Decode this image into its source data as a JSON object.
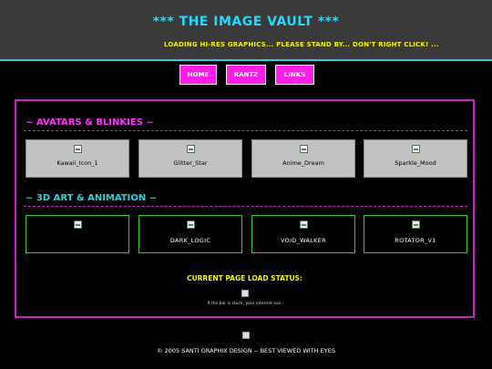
{
  "header": {
    "title": "*** THE IMAGE VAULT ***",
    "marquee": "LOADING HI-RES GRAPHICS... PLEASE STAND BY... DON'T RIGHT CLICK! ..."
  },
  "nav": {
    "items": [
      {
        "label": "HOME"
      },
      {
        "label": "RANTZ"
      },
      {
        "label": "LINKS"
      }
    ]
  },
  "sections": {
    "avatars": {
      "title": "~ AVATARS & BLINKIES ~",
      "color": "#ff33ff",
      "items": [
        "Kawaii_Icon_1",
        "Glitter_Star",
        "Anime_Dream",
        "Sparkle_Mood"
      ]
    },
    "art3d": {
      "title": "~ 3D ART & ANIMATION ~",
      "color": "#2ad2e0",
      "items": [
        "",
        "DARK_LOGIC",
        "VOID_WALKER",
        "ROTATOR_V1"
      ]
    }
  },
  "status": {
    "title": "CURRENT PAGE LOAD STATUS:",
    "note": "If the bar is stuck, your internet sux."
  },
  "footer": {
    "text": "© 2005 SANTI GRAPHIX DESIGN -- BEST VIEWED WITH EYES"
  },
  "colors": {
    "accent_cyan": "#2ad2e0",
    "accent_magenta": "#c426c2",
    "nav_button": "#ff1ee6",
    "status_yellow": "#f2f200"
  }
}
